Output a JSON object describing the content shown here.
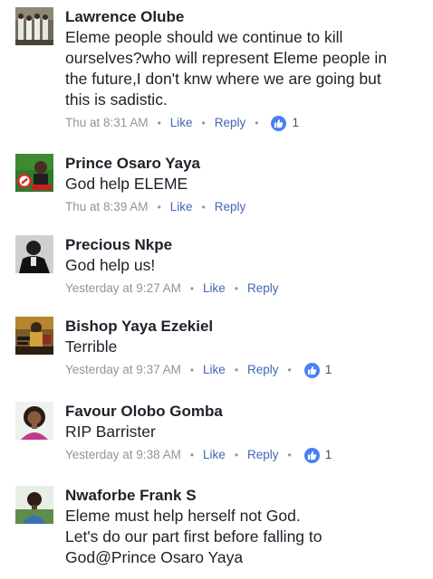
{
  "comments": [
    {
      "author": "Lawrence Olube",
      "text": "Eleme people should we continue to kill\nourselves?who will represent Eleme people in\nthe future,I don't knw where we are going but\nthis is sadistic.",
      "time": "Thu at 8:31 AM",
      "like_label": "Like",
      "reply_label": "Reply",
      "reactions": "1",
      "avatar_icon": "group-photo-avatar-icon"
    },
    {
      "author": "Prince Osaro Yaya",
      "text": "God help ELEME",
      "time": "Thu at 8:39 AM",
      "like_label": "Like",
      "reply_label": "Reply",
      "avatar_icon": "campaign-photo-avatar-icon"
    },
    {
      "author": "Precious Nkpe",
      "text": "God help us!",
      "time": "Yesterday at 9:27 AM",
      "like_label": "Like",
      "reply_label": "Reply",
      "avatar_icon": "bw-portrait-avatar-icon"
    },
    {
      "author": "Bishop Yaya Ezekiel",
      "text": "Terrible",
      "time": "Yesterday at 9:37 AM",
      "like_label": "Like",
      "reply_label": "Reply",
      "reactions": "1",
      "avatar_icon": "poster-avatar-icon"
    },
    {
      "author": "Favour Olobo Gomba",
      "text": "RIP Barrister",
      "time": "Yesterday at 9:38 AM",
      "like_label": "Like",
      "reply_label": "Reply",
      "reactions": "1",
      "avatar_icon": "woman-portrait-avatar-icon"
    },
    {
      "author": "Nwaforbe Frank S",
      "text": "Eleme must help herself not God.\nLet's do our part first before falling to\nGod@Prince Osaro Yaya",
      "avatar_icon": "man-portrait-avatar-icon"
    }
  ],
  "colors": {
    "name": "#1d2129",
    "meta": "#90949c",
    "action": "#4267b2",
    "like_badge": "#4a80f5"
  }
}
